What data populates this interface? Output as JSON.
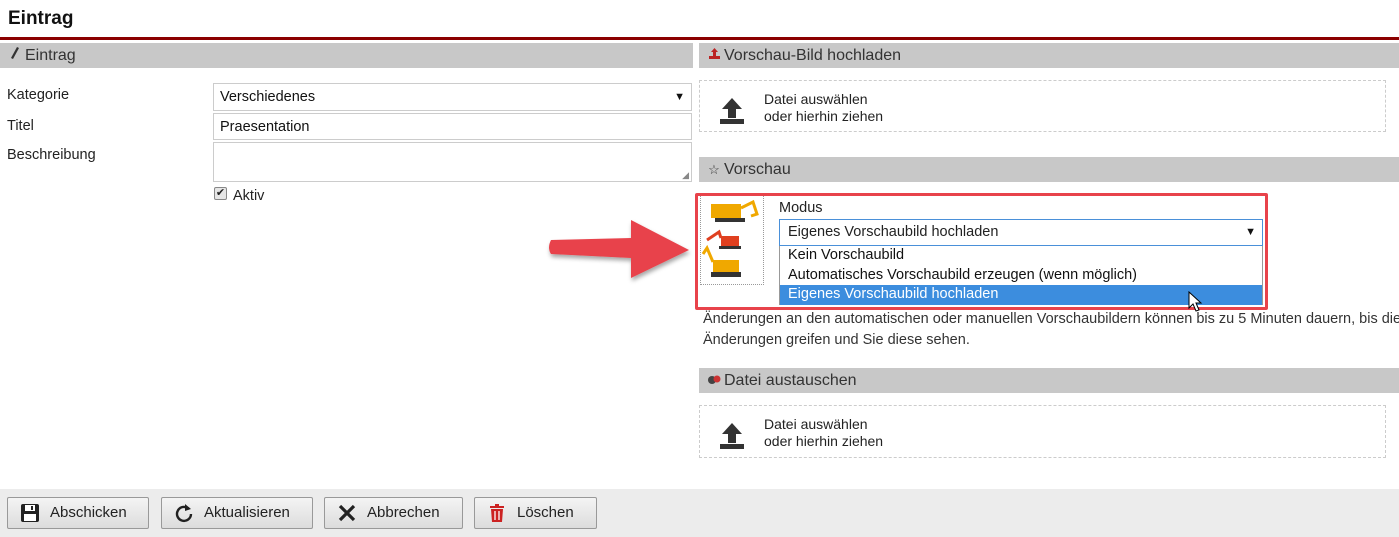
{
  "page": {
    "title": "Eintrag"
  },
  "left_section": {
    "title": "Eintrag",
    "fields": {
      "kategorie_label": "Kategorie",
      "kategorie_value": "Verschiedenes",
      "titel_label": "Titel",
      "titel_value": "Praesentation",
      "beschreibung_label": "Beschreibung",
      "beschreibung_value": "",
      "aktiv_label": "Aktiv",
      "aktiv_checked": true
    }
  },
  "vorschau_upload": {
    "title": "Vorschau-Bild hochladen",
    "dz_line1": "Datei auswählen",
    "dz_line2": "oder hierhin ziehen"
  },
  "vorschau": {
    "title": "Vorschau",
    "modus_label": "Modus",
    "modus_selected": "Eigenes Vorschaubild hochladen",
    "options": [
      "Kein Vorschaubild",
      "Automatisches Vorschaubild erzeugen (wenn möglich)",
      "Eigenes Vorschaubild hochladen"
    ],
    "note": "Änderungen an den automatischen oder manuellen Vorschaubildern können bis zu 5 Minuten dauern, bis die Änderungen greifen und Sie diese sehen."
  },
  "datei_austauschen": {
    "title": "Datei austauschen",
    "dz_line1": "Datei auswählen",
    "dz_line2": "oder hierhin ziehen"
  },
  "footer": {
    "submit": "Abschicken",
    "refresh": "Aktualisieren",
    "cancel": "Abbrechen",
    "delete": "Löschen"
  },
  "colors": {
    "header_rule": "#8b0000",
    "section_bar": "#c8c8c8",
    "highlight_box": "#e8434b",
    "selected_option": "#3c8dde"
  }
}
